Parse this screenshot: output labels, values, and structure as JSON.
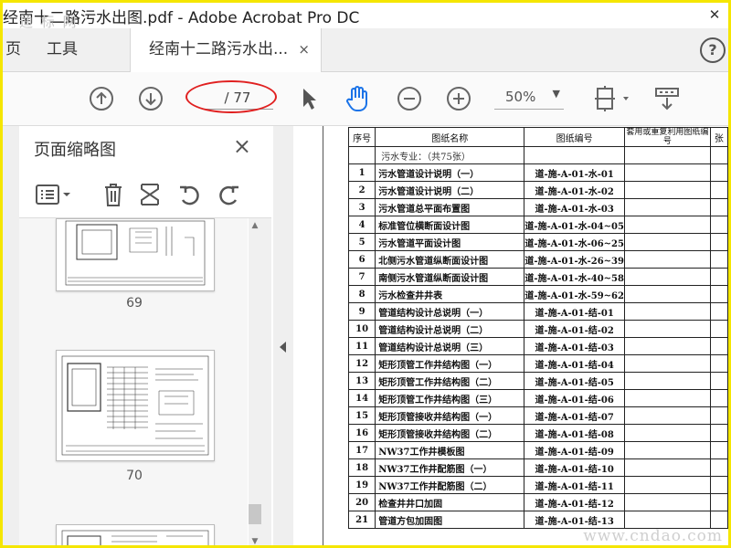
{
  "window": {
    "title": "经南十二路污水出图.pdf - Adobe Acrobat Pro DC",
    "watermark": "迪 标 网"
  },
  "tabs": {
    "home": "页",
    "tools": "工具",
    "document": "经南十二路污水出...",
    "close": "×",
    "help": "?"
  },
  "toolbar": {
    "page_indicator": "/ 77",
    "zoom": "50%"
  },
  "sidepanel": {
    "title": "页面缩略图",
    "close": "×",
    "thumbnails": [
      {
        "label": "69"
      },
      {
        "label": "70"
      }
    ]
  },
  "document": {
    "headers": [
      "序号",
      "图纸名称",
      "图纸编号",
      "套用或重复利用图纸编号",
      "张"
    ],
    "section": "污水专业：（共75张）",
    "rows": [
      {
        "n": "1",
        "name": "污水管道设计说明（一）",
        "code": "道-施-A-01-水-01"
      },
      {
        "n": "2",
        "name": "污水管道设计说明（二）",
        "code": "道-施-A-01-水-02"
      },
      {
        "n": "3",
        "name": "污水管道总平面布置图",
        "code": "道-施-A-01-水-03"
      },
      {
        "n": "4",
        "name": "标准管位横断面设计图",
        "code": "道-施-A-01-水-04~05"
      },
      {
        "n": "5",
        "name": "污水管道平面设计图",
        "code": "道-施-A-01-水-06~25"
      },
      {
        "n": "6",
        "name": "北侧污水管道纵断面设计图",
        "code": "道-施-A-01-水-26~39"
      },
      {
        "n": "7",
        "name": "南侧污水管道纵断面设计图",
        "code": "道-施-A-01-水-40~58"
      },
      {
        "n": "8",
        "name": "污水检查井井表",
        "code": "道-施-A-01-水-59~62"
      },
      {
        "n": "9",
        "name": "管道结构设计总说明（一）",
        "code": "道-施-A-01-结-01"
      },
      {
        "n": "10",
        "name": "管道结构设计总说明（二）",
        "code": "道-施-A-01-结-02"
      },
      {
        "n": "11",
        "name": "管道结构设计总说明（三）",
        "code": "道-施-A-01-结-03"
      },
      {
        "n": "12",
        "name": "矩形顶管工作井结构图（一）",
        "code": "道-施-A-01-结-04"
      },
      {
        "n": "13",
        "name": "矩形顶管工作井结构图（二）",
        "code": "道-施-A-01-结-05"
      },
      {
        "n": "14",
        "name": "矩形顶管工作井结构图（三）",
        "code": "道-施-A-01-结-06"
      },
      {
        "n": "15",
        "name": "矩形顶管接收井结构图（一）",
        "code": "道-施-A-01-结-07"
      },
      {
        "n": "16",
        "name": "矩形顶管接收井结构图（二）",
        "code": "道-施-A-01-结-08"
      },
      {
        "n": "17",
        "name": "NW37工作井模板图",
        "code": "道-施-A-01-结-09"
      },
      {
        "n": "18",
        "name": "NW37工作井配筋图（一）",
        "code": "道-施-A-01-结-10"
      },
      {
        "n": "19",
        "name": "NW37工作井配筋图（二）",
        "code": "道-施-A-01-结-11"
      },
      {
        "n": "20",
        "name": "检查井井口加固",
        "code": "道-施-A-01-结-12"
      },
      {
        "n": "21",
        "name": "管道方包加固图",
        "code": "道-施-A-01-结-13"
      }
    ],
    "watermark": "www.cndao.com"
  },
  "colors": {
    "frame": "#f5e600",
    "highlight_ellipse": "#e02020",
    "hand_tool": "#1a73e8"
  },
  "icons": [
    "arrow-up-circle-icon",
    "arrow-down-circle-icon",
    "cursor-icon",
    "hand-icon",
    "zoom-out-icon",
    "zoom-in-icon",
    "fit-page-icon",
    "scroll-mode-icon",
    "options-icon",
    "delete-icon",
    "crop-icon",
    "undo-icon",
    "redo-icon"
  ]
}
